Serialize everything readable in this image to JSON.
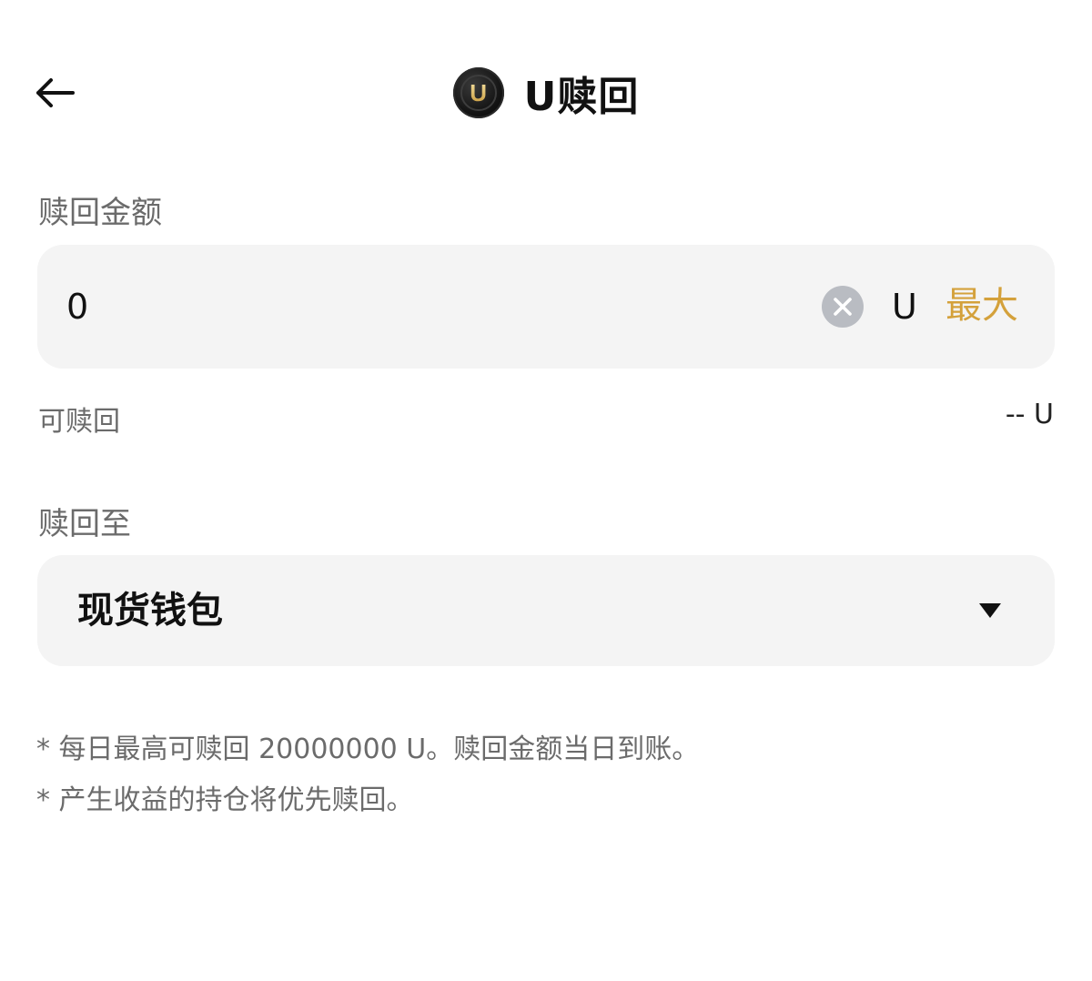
{
  "header": {
    "title": "U赎回",
    "coin_letter": "U",
    "back_icon": "arrow-left-icon"
  },
  "amount": {
    "label": "赎回金额",
    "value": "0",
    "unit": "U",
    "max_label": "最大",
    "clear_icon": "close-circle-icon",
    "max_color": "#d4a13b"
  },
  "available": {
    "label": "可赎回",
    "value": "-- U"
  },
  "destination": {
    "label": "赎回至",
    "selected": "现货钱包",
    "dropdown_icon": "caret-down-icon"
  },
  "notes": [
    "* 每日最高可赎回 20000000 U。赎回金额当日到账。",
    "* 产生收益的持仓将优先赎回。"
  ]
}
